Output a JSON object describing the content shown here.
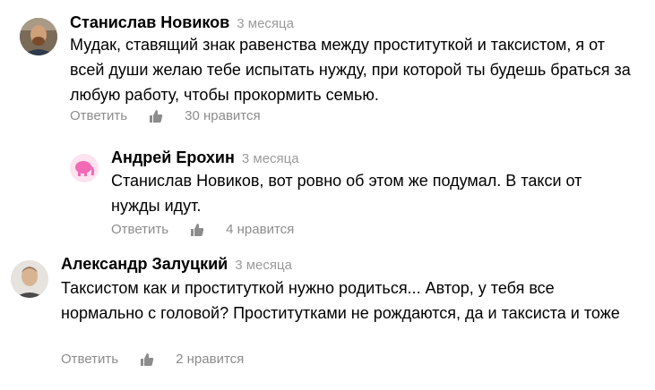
{
  "comments": [
    {
      "author": "Станислав Новиков",
      "time": "3 месяца",
      "text": "Мудак, ставящий знак равенства между проституткой и таксистом, я от всей души желаю тебе испытать нужду, при которой ты будешь браться за любую работу, чтобы прокормить семью.",
      "reply_label": "Ответить",
      "likes": "30 нравится"
    },
    {
      "author": "Андрей Ерохин",
      "time": "3 месяца",
      "text": "Станислав Новиков, вот ровно об этом же подумал. В такси от нужды идут.",
      "reply_label": "Ответить",
      "likes": "4 нравится"
    },
    {
      "author": "Александр Залуцкий",
      "time": "3 месяца",
      "text": "Таксистом как и проституткой нужно родиться... Автор, у тебя все нормально с головой? Проститутками не рождаются, да и таксиста и тоже",
      "reply_label": "Ответить",
      "likes": "2 нравится"
    }
  ],
  "icons": {
    "like": "thumbs-up-icon"
  },
  "colors": {
    "meta_text": "#9a9a9a",
    "action_text": "#8c8c8c",
    "avatar_pink": "#f06bb4"
  }
}
